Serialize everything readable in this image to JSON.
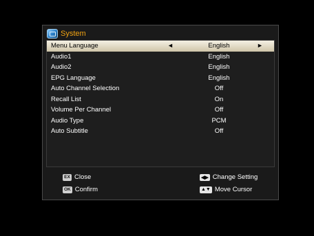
{
  "title": "System",
  "menu": [
    {
      "label": "Menu Language",
      "value": "English",
      "selected": true
    },
    {
      "label": "Audio1",
      "value": "English"
    },
    {
      "label": "Audio2",
      "value": "English"
    },
    {
      "label": "EPG Language",
      "value": "English"
    },
    {
      "label": "Auto Channel Selection",
      "value": "Off"
    },
    {
      "label": "Recall List",
      "value": "On"
    },
    {
      "label": "Volume Per Channel",
      "value": "Off"
    },
    {
      "label": "Audio Type",
      "value": "PCM"
    },
    {
      "label": "Auto Subtitle",
      "value": "Off"
    }
  ],
  "legend": {
    "close": {
      "key": "EX",
      "label": "Close"
    },
    "confirm": {
      "key": "OK",
      "label": "Confirm"
    },
    "change": {
      "key": "◀▶",
      "label": "Change Setting"
    },
    "move": {
      "key": "▲▼",
      "label": "Move Cursor"
    }
  },
  "arrows": {
    "left": "◄",
    "right": "►"
  }
}
